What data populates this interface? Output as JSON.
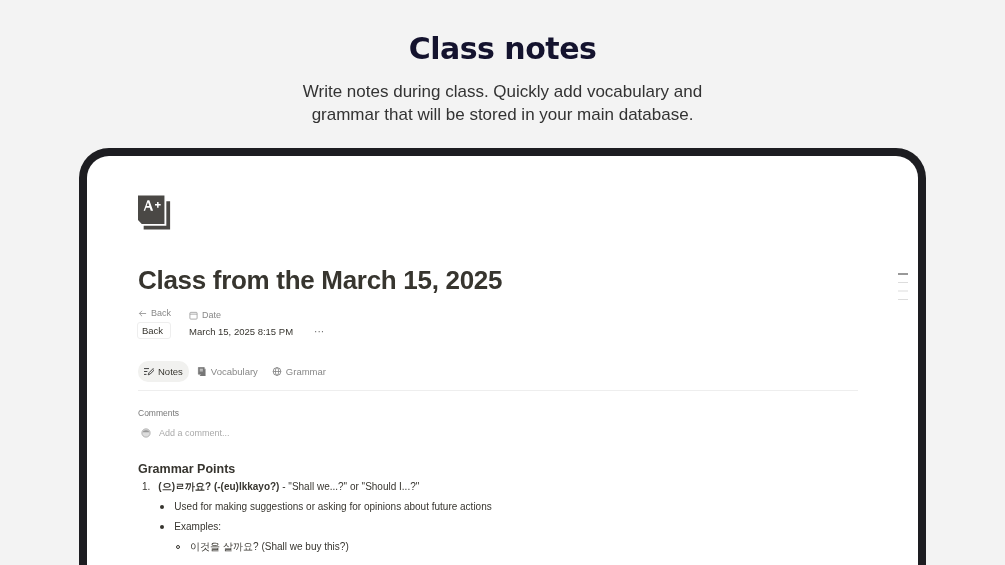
{
  "header": {
    "title": "Class notes",
    "subtitle": "Write notes during class. Quickly add vocabulary and grammar that will be stored in your main database."
  },
  "page": {
    "title": "Class from the March 15, 2025",
    "properties": [
      {
        "name": "Back",
        "value": "Back",
        "kind": "relation"
      },
      {
        "name": "Date",
        "value": "March 15, 2025 8:15 PM",
        "kind": "date"
      }
    ],
    "more": "···",
    "tabs": [
      {
        "label": "Notes",
        "selected": true
      },
      {
        "label": "Vocabulary",
        "selected": false
      },
      {
        "label": "Grammar",
        "selected": false
      }
    ],
    "comments": {
      "label": "Comments",
      "placeholder": "Add a comment..."
    },
    "section_title": "Grammar Points",
    "list": [
      {
        "marker": "1.",
        "text": "**(으)ㄹ까요? (-(eu)lkkayo?)** - \"Shall we...?\" or \"Should I...?\"",
        "children": [
          {
            "text": "Used for making suggestions or asking for opinions about future actions"
          },
          {
            "text": "Examples:",
            "children": [
              {
                "text": "이것을 살까요? (Shall we buy this?)"
              }
            ]
          }
        ]
      }
    ]
  }
}
